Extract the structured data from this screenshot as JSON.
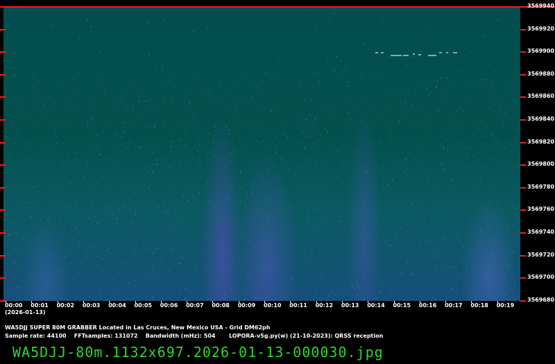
{
  "window": {
    "image_filename": "WA5DJJ-80m.1132x697.2026-01-13-000030.jpg"
  },
  "spectrogram": {
    "freq_axis_hz": [
      "3569940",
      "3569920",
      "3569900",
      "3569880",
      "3569860",
      "3569840",
      "3569820",
      "3569800",
      "3569780",
      "3569760",
      "3569740",
      "3569720",
      "3569700",
      "3569680"
    ],
    "time_axis_labels": [
      "00:00",
      "00:01",
      "00:02",
      "00:03",
      "00:04",
      "00:05",
      "00:06",
      "00:07",
      "00:08",
      "00:09",
      "00:10",
      "00:11",
      "00:12",
      "00:13",
      "00:14",
      "00:15",
      "00:16",
      "00:17",
      "00:18",
      "00:19"
    ],
    "date_label": "(2026-01-13)",
    "colors": {
      "background": "#024e4f",
      "marker": "#ff1a1a",
      "filename": "#2fd62f"
    }
  },
  "info": {
    "station_line": "WA5DJJ SUPER 80M GRABBER Located in Las Cruces, New Mexico USA - Grid DM62ph",
    "params_line": "Sample rate: 44100    FFTsamples: 131072    Bandwidth (mHz): 504       LOPORA-v5g.py(w) (21-10-2023): QRSS reception"
  }
}
